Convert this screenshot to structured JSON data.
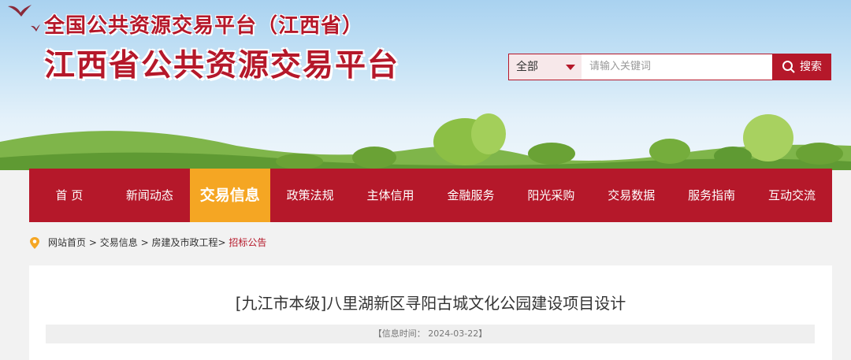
{
  "header": {
    "title_top": "全国公共资源交易平台（江西省）",
    "title_main": "江西省公共资源交易平台"
  },
  "search": {
    "category": "全部",
    "placeholder": "请输入关键词",
    "button_label": "搜索"
  },
  "nav": {
    "items": [
      {
        "label": "首 页"
      },
      {
        "label": "新闻动态"
      },
      {
        "label": "交易信息"
      },
      {
        "label": "政策法规"
      },
      {
        "label": "主体信用"
      },
      {
        "label": "金融服务"
      },
      {
        "label": "阳光采购"
      },
      {
        "label": "交易数据"
      },
      {
        "label": "服务指南"
      },
      {
        "label": "互动交流"
      }
    ],
    "active_index": 2
  },
  "breadcrumb": {
    "home": "网站首页",
    "sep": ">",
    "level1": "交易信息",
    "level2": "房建及市政工程",
    "current": "招标公告"
  },
  "article": {
    "title": "[九江市本级]八里湖新区寻阳古城文化公园建设项目设计",
    "meta": "【信息时间： 2024-03-22】"
  },
  "colors": {
    "brand_red": "#b5182a",
    "active_orange": "#f5a623"
  }
}
